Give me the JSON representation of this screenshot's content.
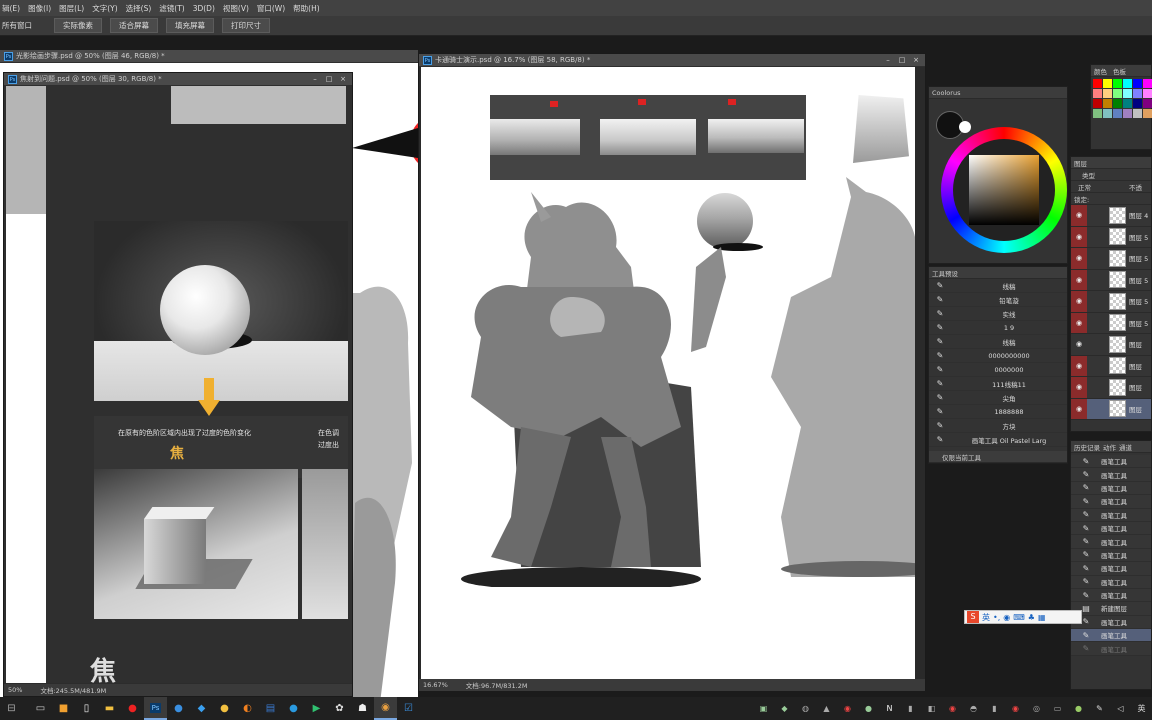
{
  "menubar": [
    "辑(E)",
    "图像(I)",
    "图层(L)",
    "文字(Y)",
    "选择(S)",
    "滤镜(T)",
    "3D(D)",
    "视图(V)",
    "窗口(W)",
    "帮助(H)"
  ],
  "options": {
    "label": "所有窗口",
    "buttons": [
      "实际像素",
      "适合屏幕",
      "填充屏幕",
      "打印尺寸"
    ]
  },
  "windows": {
    "back": {
      "title": "光影绘画步骤.psd @ 50% (图层 46, RGB/8) *"
    },
    "left": {
      "title": "焦射到问题.psd @ 50% (图层 30, RGB/8) *",
      "caption": "在原有的色阶区域内出现了过度的色阶变化",
      "caption_right_1": "在色调",
      "caption_right_2": "过度出",
      "char_small": "焦",
      "char_big": "焦",
      "zoom": "50%",
      "doc": "文档:245.5M/481.9M"
    },
    "main": {
      "title": "卡通骑士演示.psd @ 16.7% (图层 58, RGB/8) *",
      "zoom": "16.67%",
      "doc": "文档:96.7M/831.2M"
    }
  },
  "swatches": {
    "tabs": [
      "颜色",
      "色板"
    ],
    "colors": [
      "#ff0000",
      "#ffff00",
      "#00ff00",
      "#00ffff",
      "#0000ff",
      "#ff00ff",
      "#ffffff",
      "#cccccc",
      "#ff8080",
      "#ffd080",
      "#80ff80",
      "#80ffff",
      "#8080ff",
      "#ff80ff",
      "#999999",
      "#666666",
      "#c00000",
      "#c08000",
      "#008000",
      "#008080",
      "#000080",
      "#800080",
      "#333333",
      "#000000",
      "#80c080",
      "#80c0c0",
      "#6080c0",
      "#a080c0",
      "#c0c0c0",
      "#e0a060",
      "#a0a0a0",
      "#808080"
    ]
  },
  "coolorus": {
    "title": "Coolorus"
  },
  "tool_presets": {
    "title": "工具预设",
    "items": [
      "线稿",
      "铅笔漩",
      "实线",
      "1    9",
      "线稿",
      "0000000000",
      "0000000",
      "111线稿11",
      "尖角",
      "1888888",
      "方块",
      "画笔工具 Oil Pastel Larg"
    ],
    "footer": "仅限当前工具"
  },
  "layers": {
    "title": "图层",
    "filter": "类型",
    "blend": "正常",
    "blend_right": "不透",
    "lock": "锁定:",
    "items": [
      "图层 4",
      "图层 5",
      "图层 5",
      "图层 5",
      "图层 5",
      "图层 5",
      "图层",
      "图层",
      "图层",
      "图层"
    ]
  },
  "history": {
    "tabs": [
      "历史记录",
      "动作",
      "通道"
    ],
    "items": [
      "画笔工具",
      "画笔工具",
      "画笔工具",
      "画笔工具",
      "画笔工具",
      "画笔工具",
      "画笔工具",
      "画笔工具",
      "画笔工具",
      "画笔工具",
      "画笔工具",
      "新建图层",
      "画笔工具",
      "画笔工具",
      "画笔工具"
    ]
  },
  "ime": {
    "label": "英"
  },
  "tray": {
    "lang": "英"
  },
  "colors": {
    "accent": "#79a7e0",
    "layer_eye": "#8b2b2b",
    "arrow": "#f0b030"
  }
}
